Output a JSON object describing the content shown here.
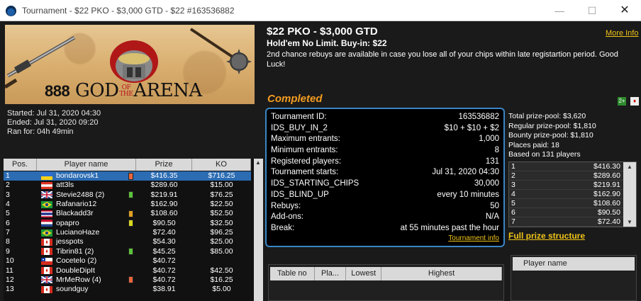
{
  "window": {
    "title": "Tournament - $22 PKO - $3,000 GTD - $22 #163536882",
    "minimize": "—",
    "maximize": "☐",
    "close": "✕"
  },
  "banner": {
    "brand": "888",
    "name_left": "GOD",
    "of": "OF",
    "the": "THE",
    "name_right": "ARENA"
  },
  "times": {
    "started": "Started: Jul 31, 2020 04:30",
    "ended": "Ended: Jul 31, 2020 09:20",
    "ran": "Ran for: 04h 49min"
  },
  "event": {
    "title": "$22 PKO - $3,000 GTD",
    "more_info": "More Info",
    "subtitle": "Hold'em No Limit. Buy-in: $22",
    "description": "2nd chance rebuys are available in case you lose all of your chips within late registartion period. Good Luck!",
    "status": "Completed"
  },
  "details": {
    "rows": [
      {
        "label": "Tournament ID:",
        "value": "163536882"
      },
      {
        "label": "IDS_BUY_IN_2",
        "value": "$10 + $10 + $2"
      },
      {
        "label": "Maximum entrants:",
        "value": "1,000"
      },
      {
        "label": "Minimum entrants:",
        "value": "8"
      },
      {
        "label": "Registered players:",
        "value": "131"
      },
      {
        "label": "Tournament starts:",
        "value": "Jul 31, 2020 04:30"
      },
      {
        "label": "IDS_STARTING_CHIPS",
        "value": "30,000"
      },
      {
        "label": "IDS_BLIND_UP",
        "value": "every 10 minutes"
      },
      {
        "label": "Rebuys:",
        "value": "50"
      },
      {
        "label": "Add-ons:",
        "value": "N/A"
      },
      {
        "label": "Break:",
        "value": "at 55 minutes past the hour"
      }
    ],
    "link": "Tournament info"
  },
  "prize_pool": {
    "total": "Total prize-pool: $3,620",
    "regular": "Regular prize-pool: $1,810",
    "bounty": "Bounty prize-pool: $1,810",
    "places": "Places paid: 18",
    "based": "Based on 131 players",
    "rows": [
      {
        "place": "1",
        "amount": "$416.30"
      },
      {
        "place": "2",
        "amount": "$289.60"
      },
      {
        "place": "3",
        "amount": "$219.91"
      },
      {
        "place": "4",
        "amount": "$162.90"
      },
      {
        "place": "5",
        "amount": "$108.60"
      },
      {
        "place": "6",
        "amount": "$90.50"
      },
      {
        "place": "7",
        "amount": "$72.40"
      }
    ],
    "full_link": "Full prize structure"
  },
  "players": {
    "headers": {
      "pos": "Pos.",
      "name": "Player name",
      "prize": "Prize",
      "ko": "KO"
    },
    "rows": [
      {
        "pos": "1",
        "name": "bondarovsk1",
        "prize": "$416.35",
        "ko": "$716.25",
        "flag": "ua",
        "note": "#e8663d"
      },
      {
        "pos": "2",
        "name": "att3ls",
        "prize": "$289.60",
        "ko": "$15.00",
        "flag": "at",
        "note": ""
      },
      {
        "pos": "3",
        "name": "Stevie2488 (2)",
        "prize": "$219.91",
        "ko": "$76.25",
        "flag": "uk",
        "note": "#5cc23a"
      },
      {
        "pos": "4",
        "name": "Rafanario12",
        "prize": "$162.90",
        "ko": "$22.50",
        "flag": "br",
        "note": ""
      },
      {
        "pos": "5",
        "name": "Blackadd3r",
        "prize": "$108.60",
        "ko": "$52.50",
        "flag": "th",
        "note": "#e0a020"
      },
      {
        "pos": "6",
        "name": "opapro",
        "prize": "$90.50",
        "ko": "$32.50",
        "flag": "nl",
        "note": "#d8d820"
      },
      {
        "pos": "7",
        "name": "LucianoHaze",
        "prize": "$72.40",
        "ko": "$96.25",
        "flag": "br",
        "note": ""
      },
      {
        "pos": "8",
        "name": "jesspots",
        "prize": "$54.30",
        "ko": "$25.00",
        "flag": "ca",
        "note": ""
      },
      {
        "pos": "9",
        "name": "Tibrin81 (2)",
        "prize": "$45.25",
        "ko": "$85.00",
        "flag": "ca",
        "note": "#5cc23a"
      },
      {
        "pos": "10",
        "name": "Cocetelo (2)",
        "prize": "$40.72",
        "ko": "",
        "flag": "cl",
        "note": ""
      },
      {
        "pos": "11",
        "name": "DoubleDipIt",
        "prize": "$40.72",
        "ko": "$42.50",
        "flag": "ca",
        "note": ""
      },
      {
        "pos": "12",
        "name": "MrMeRow (4)",
        "prize": "$40.72",
        "ko": "$16.25",
        "flag": "uk",
        "note": "#e8663d"
      },
      {
        "pos": "13",
        "name": "soundguy",
        "prize": "$38.91",
        "ko": "$5.00",
        "flag": "ca",
        "note": ""
      }
    ]
  },
  "tables_grid": {
    "headers": [
      "Table no",
      "Pla...",
      "Lowest",
      "Highest"
    ]
  },
  "players_grid": {
    "header": "Player name"
  }
}
